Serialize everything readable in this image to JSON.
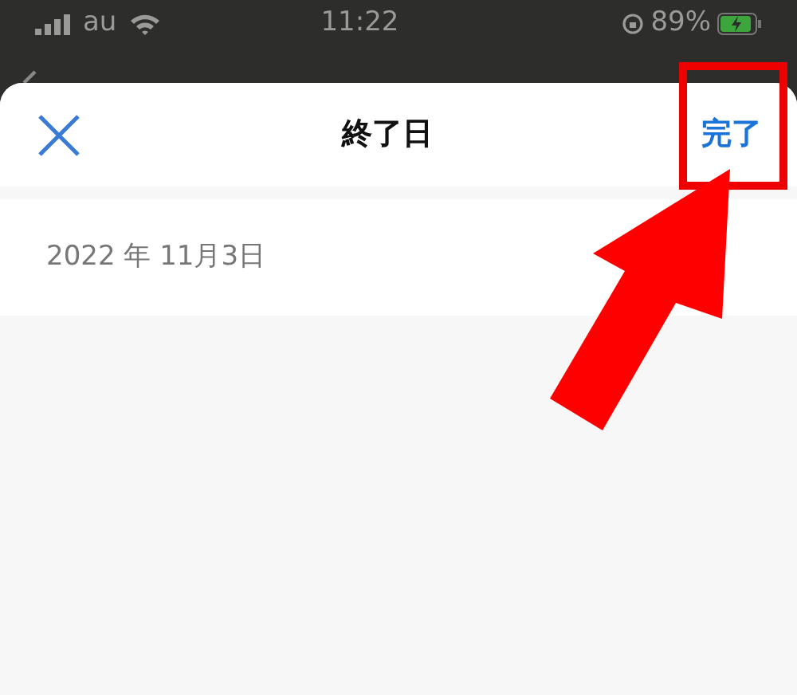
{
  "status_bar": {
    "carrier": "au",
    "time": "11:22",
    "battery": "89%"
  },
  "sheet": {
    "title": "終了日",
    "done_button": "完了",
    "date_value": "2022 年 11月3日"
  }
}
